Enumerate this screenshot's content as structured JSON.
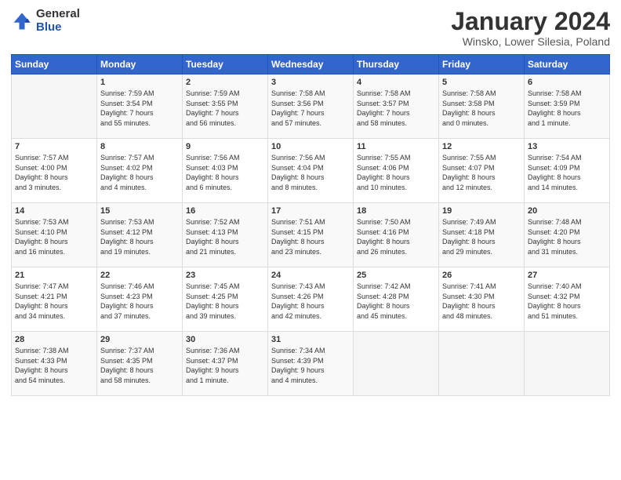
{
  "header": {
    "logo_general": "General",
    "logo_blue": "Blue",
    "title": "January 2024",
    "location": "Winsko, Lower Silesia, Poland"
  },
  "days_of_week": [
    "Sunday",
    "Monday",
    "Tuesday",
    "Wednesday",
    "Thursday",
    "Friday",
    "Saturday"
  ],
  "weeks": [
    [
      {
        "day": "",
        "content": ""
      },
      {
        "day": "1",
        "content": "Sunrise: 7:59 AM\nSunset: 3:54 PM\nDaylight: 7 hours\nand 55 minutes."
      },
      {
        "day": "2",
        "content": "Sunrise: 7:59 AM\nSunset: 3:55 PM\nDaylight: 7 hours\nand 56 minutes."
      },
      {
        "day": "3",
        "content": "Sunrise: 7:58 AM\nSunset: 3:56 PM\nDaylight: 7 hours\nand 57 minutes."
      },
      {
        "day": "4",
        "content": "Sunrise: 7:58 AM\nSunset: 3:57 PM\nDaylight: 7 hours\nand 58 minutes."
      },
      {
        "day": "5",
        "content": "Sunrise: 7:58 AM\nSunset: 3:58 PM\nDaylight: 8 hours\nand 0 minutes."
      },
      {
        "day": "6",
        "content": "Sunrise: 7:58 AM\nSunset: 3:59 PM\nDaylight: 8 hours\nand 1 minute."
      }
    ],
    [
      {
        "day": "7",
        "content": "Sunrise: 7:57 AM\nSunset: 4:00 PM\nDaylight: 8 hours\nand 3 minutes."
      },
      {
        "day": "8",
        "content": "Sunrise: 7:57 AM\nSunset: 4:02 PM\nDaylight: 8 hours\nand 4 minutes."
      },
      {
        "day": "9",
        "content": "Sunrise: 7:56 AM\nSunset: 4:03 PM\nDaylight: 8 hours\nand 6 minutes."
      },
      {
        "day": "10",
        "content": "Sunrise: 7:56 AM\nSunset: 4:04 PM\nDaylight: 8 hours\nand 8 minutes."
      },
      {
        "day": "11",
        "content": "Sunrise: 7:55 AM\nSunset: 4:06 PM\nDaylight: 8 hours\nand 10 minutes."
      },
      {
        "day": "12",
        "content": "Sunrise: 7:55 AM\nSunset: 4:07 PM\nDaylight: 8 hours\nand 12 minutes."
      },
      {
        "day": "13",
        "content": "Sunrise: 7:54 AM\nSunset: 4:09 PM\nDaylight: 8 hours\nand 14 minutes."
      }
    ],
    [
      {
        "day": "14",
        "content": "Sunrise: 7:53 AM\nSunset: 4:10 PM\nDaylight: 8 hours\nand 16 minutes."
      },
      {
        "day": "15",
        "content": "Sunrise: 7:53 AM\nSunset: 4:12 PM\nDaylight: 8 hours\nand 19 minutes."
      },
      {
        "day": "16",
        "content": "Sunrise: 7:52 AM\nSunset: 4:13 PM\nDaylight: 8 hours\nand 21 minutes."
      },
      {
        "day": "17",
        "content": "Sunrise: 7:51 AM\nSunset: 4:15 PM\nDaylight: 8 hours\nand 23 minutes."
      },
      {
        "day": "18",
        "content": "Sunrise: 7:50 AM\nSunset: 4:16 PM\nDaylight: 8 hours\nand 26 minutes."
      },
      {
        "day": "19",
        "content": "Sunrise: 7:49 AM\nSunset: 4:18 PM\nDaylight: 8 hours\nand 29 minutes."
      },
      {
        "day": "20",
        "content": "Sunrise: 7:48 AM\nSunset: 4:20 PM\nDaylight: 8 hours\nand 31 minutes."
      }
    ],
    [
      {
        "day": "21",
        "content": "Sunrise: 7:47 AM\nSunset: 4:21 PM\nDaylight: 8 hours\nand 34 minutes."
      },
      {
        "day": "22",
        "content": "Sunrise: 7:46 AM\nSunset: 4:23 PM\nDaylight: 8 hours\nand 37 minutes."
      },
      {
        "day": "23",
        "content": "Sunrise: 7:45 AM\nSunset: 4:25 PM\nDaylight: 8 hours\nand 39 minutes."
      },
      {
        "day": "24",
        "content": "Sunrise: 7:43 AM\nSunset: 4:26 PM\nDaylight: 8 hours\nand 42 minutes."
      },
      {
        "day": "25",
        "content": "Sunrise: 7:42 AM\nSunset: 4:28 PM\nDaylight: 8 hours\nand 45 minutes."
      },
      {
        "day": "26",
        "content": "Sunrise: 7:41 AM\nSunset: 4:30 PM\nDaylight: 8 hours\nand 48 minutes."
      },
      {
        "day": "27",
        "content": "Sunrise: 7:40 AM\nSunset: 4:32 PM\nDaylight: 8 hours\nand 51 minutes."
      }
    ],
    [
      {
        "day": "28",
        "content": "Sunrise: 7:38 AM\nSunset: 4:33 PM\nDaylight: 8 hours\nand 54 minutes."
      },
      {
        "day": "29",
        "content": "Sunrise: 7:37 AM\nSunset: 4:35 PM\nDaylight: 8 hours\nand 58 minutes."
      },
      {
        "day": "30",
        "content": "Sunrise: 7:36 AM\nSunset: 4:37 PM\nDaylight: 9 hours\nand 1 minute."
      },
      {
        "day": "31",
        "content": "Sunrise: 7:34 AM\nSunset: 4:39 PM\nDaylight: 9 hours\nand 4 minutes."
      },
      {
        "day": "",
        "content": ""
      },
      {
        "day": "",
        "content": ""
      },
      {
        "day": "",
        "content": ""
      }
    ]
  ]
}
